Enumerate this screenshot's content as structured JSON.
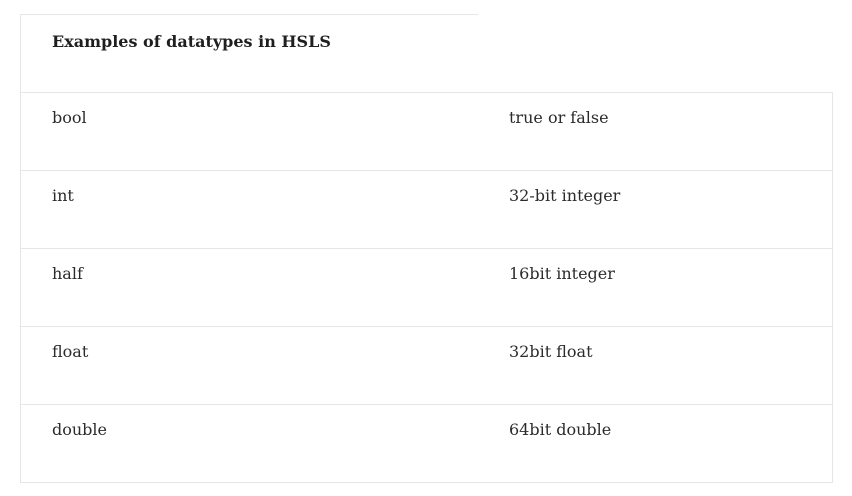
{
  "table": {
    "title": "Examples of datatypes in HSLS",
    "rows": [
      {
        "type": "bool",
        "description": "true or false"
      },
      {
        "type": "int",
        "description": "32-bit integer"
      },
      {
        "type": "half",
        "description": "16bit integer"
      },
      {
        "type": "float",
        "description": "32bit float"
      },
      {
        "type": "double",
        "description": "64bit double"
      }
    ]
  }
}
